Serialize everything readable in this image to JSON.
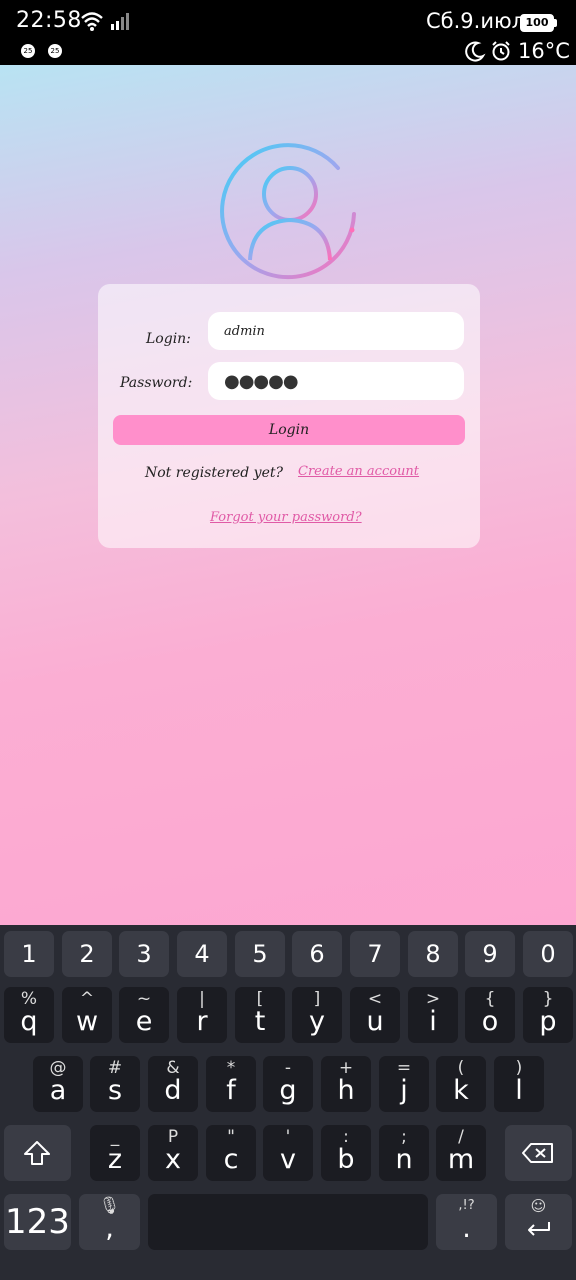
{
  "status_bar": {
    "time": "22:58",
    "date": "Сб.9.июл",
    "battery": "100",
    "temperature": "16°C",
    "notif_1": "25",
    "notif_2": "25"
  },
  "login_form": {
    "login_label": "Login:",
    "password_label": "Password:",
    "login_value": "admin",
    "password_value": "●●●●●",
    "login_button": "Login",
    "not_registered_text": "Not registered yet?",
    "create_account_link": "Create an account",
    "forgot_password_link": "Forgot your password?"
  },
  "keyboard": {
    "numbers": [
      "1",
      "2",
      "3",
      "4",
      "5",
      "6",
      "7",
      "8",
      "9",
      "0"
    ],
    "row1": [
      {
        "sub": "%",
        "main": "q"
      },
      {
        "sub": "^",
        "main": "w"
      },
      {
        "sub": "~",
        "main": "e"
      },
      {
        "sub": "|",
        "main": "r"
      },
      {
        "sub": "[",
        "main": "t"
      },
      {
        "sub": "]",
        "main": "y"
      },
      {
        "sub": "<",
        "main": "u"
      },
      {
        "sub": ">",
        "main": "i"
      },
      {
        "sub": "{",
        "main": "o"
      },
      {
        "sub": "}",
        "main": "p"
      }
    ],
    "row2": [
      {
        "sub": "@",
        "main": "a"
      },
      {
        "sub": "#",
        "main": "s"
      },
      {
        "sub": "&",
        "main": "d"
      },
      {
        "sub": "*",
        "main": "f"
      },
      {
        "sub": "-",
        "main": "g"
      },
      {
        "sub": "+",
        "main": "h"
      },
      {
        "sub": "=",
        "main": "j"
      },
      {
        "sub": "(",
        "main": "k"
      },
      {
        "sub": ")",
        "main": "l"
      }
    ],
    "row3": [
      {
        "sub": "_",
        "main": "z"
      },
      {
        "sub": "P",
        "main": "x"
      },
      {
        "sub": "\"",
        "main": "c"
      },
      {
        "sub": "'",
        "main": "v"
      },
      {
        "sub": ":",
        "main": "b"
      },
      {
        "sub": ";",
        "main": "n"
      },
      {
        "sub": "/",
        "main": "m"
      }
    ],
    "mode_key": "123",
    "comma_key": ",",
    "period_key": ".",
    "period_sub": ",!?"
  },
  "icons": {
    "shift": "shift-icon",
    "backspace": "backspace-icon",
    "enter": "enter-icon",
    "mic": "mic-icon",
    "emoji": "emoji-icon"
  },
  "colors": {
    "accent": "#ff8fcb",
    "link": "#e05aa6",
    "keyboard_bg": "#292b33"
  }
}
